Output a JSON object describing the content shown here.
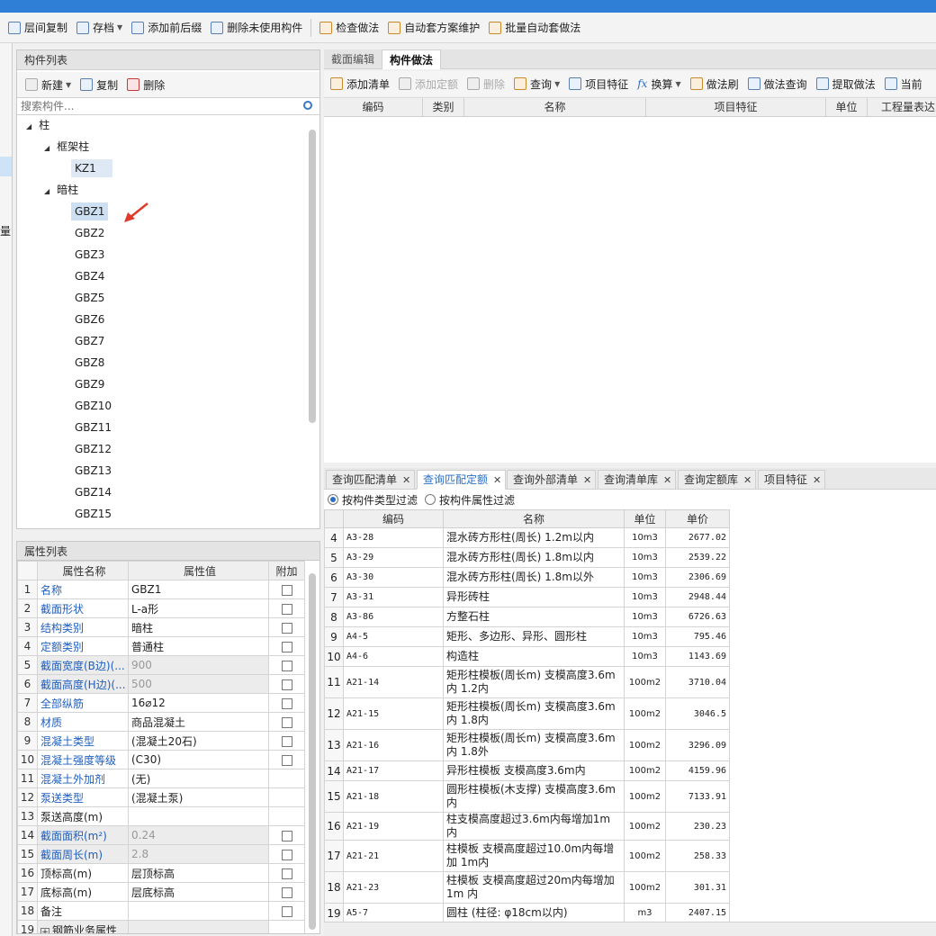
{
  "toolbar": {
    "items": [
      {
        "label": "层间复制",
        "icon": "copy-layers-icon"
      },
      {
        "label": "存档",
        "icon": "save-icon",
        "dropdown": true
      },
      {
        "label": "添加前后缀",
        "icon": "prefix-icon"
      },
      {
        "label": "删除未使用构件",
        "icon": "delete-unused-icon"
      },
      {
        "label": "检查做法",
        "icon": "check-method-icon"
      },
      {
        "label": "自动套方案维护",
        "icon": "auto-scheme-icon"
      },
      {
        "label": "批量自动套做法",
        "icon": "batch-auto-icon"
      }
    ]
  },
  "left_strip": {
    "partial_text": "用量"
  },
  "component_list": {
    "title": "构件列表",
    "new_label": "新建",
    "copy_label": "复制",
    "delete_label": "删除",
    "search_placeholder": "搜索构件...",
    "tree": {
      "root": "柱",
      "groups": [
        {
          "label": "框架柱",
          "items": [
            "KZ1"
          ]
        },
        {
          "label": "暗柱",
          "items": [
            "GBZ1",
            "GBZ2",
            "GBZ3",
            "GBZ4",
            "GBZ5",
            "GBZ6",
            "GBZ7",
            "GBZ8",
            "GBZ9",
            "GBZ10",
            "GBZ11",
            "GBZ12",
            "GBZ13",
            "GBZ14",
            "GBZ15"
          ]
        }
      ]
    }
  },
  "property_list": {
    "title": "属性列表",
    "headers": [
      "属性名称",
      "属性值",
      "附加"
    ],
    "rows": [
      {
        "n": "1",
        "name": "名称",
        "value": "GBZ1"
      },
      {
        "n": "2",
        "name": "截面形状",
        "value": "L-a形"
      },
      {
        "n": "3",
        "name": "结构类别",
        "value": "暗柱"
      },
      {
        "n": "4",
        "name": "定额类别",
        "value": "普通柱"
      },
      {
        "n": "5",
        "name": "截面宽度(B边)(...",
        "value": "900"
      },
      {
        "n": "6",
        "name": "截面高度(H边)(...",
        "value": "500"
      },
      {
        "n": "7",
        "name": "全部纵筋",
        "value": "16⌀12"
      },
      {
        "n": "8",
        "name": "材质",
        "value": "商品混凝土"
      },
      {
        "n": "9",
        "name": "混凝土类型",
        "value": "(混凝土20石)"
      },
      {
        "n": "10",
        "name": "混凝土强度等级",
        "value": "(C30)"
      },
      {
        "n": "11",
        "name": "混凝土外加剂",
        "value": "(无)"
      },
      {
        "n": "12",
        "name": "泵送类型",
        "value": "(混凝土泵)"
      },
      {
        "n": "13",
        "name": "泵送高度(m)",
        "value": ""
      },
      {
        "n": "14",
        "name": "截面面积(m²)",
        "value": "0.24"
      },
      {
        "n": "15",
        "name": "截面周长(m)",
        "value": "2.8"
      },
      {
        "n": "16",
        "name": "顶标高(m)",
        "value": "层顶标高"
      },
      {
        "n": "17",
        "name": "底标高(m)",
        "value": "层底标高"
      },
      {
        "n": "18",
        "name": "备注",
        "value": ""
      },
      {
        "n": "19",
        "name": "钢筋业务属性",
        "value": ""
      }
    ]
  },
  "right_tabs": {
    "section_edit": "截面编辑",
    "component_method": "构件做法"
  },
  "right_toolbar": {
    "add_list": "添加清单",
    "add_quota": "添加定额",
    "delete": "删除",
    "query": "查询",
    "item_feature": "项目特征",
    "convert": "换算",
    "method_brush": "做法刷",
    "method_query": "做法查询",
    "extract_method": "提取做法",
    "current": "当前"
  },
  "method_grid_headers": [
    "编码",
    "类别",
    "名称",
    "项目特征",
    "单位",
    "工程量表达"
  ],
  "bottom_tabs": [
    "查询匹配清单",
    "查询匹配定额",
    "查询外部清单",
    "查询清单库",
    "查询定额库",
    "项目特征"
  ],
  "filters": {
    "by_type": "按构件类型过滤",
    "by_attr": "按构件属性过滤"
  },
  "quota_table": {
    "headers": [
      "编码",
      "名称",
      "单位",
      "单价"
    ],
    "rows": [
      {
        "n": "4",
        "code": "A3-28",
        "name": "混水砖方形柱(周长) 1.2m以内",
        "unit": "10m3",
        "price": "2677.02"
      },
      {
        "n": "5",
        "code": "A3-29",
        "name": "混水砖方形柱(周长) 1.8m以内",
        "unit": "10m3",
        "price": "2539.22"
      },
      {
        "n": "6",
        "code": "A3-30",
        "name": "混水砖方形柱(周长) 1.8m以外",
        "unit": "10m3",
        "price": "2306.69"
      },
      {
        "n": "7",
        "code": "A3-31",
        "name": "异形砖柱",
        "unit": "10m3",
        "price": "2948.44"
      },
      {
        "n": "8",
        "code": "A3-86",
        "name": "方整石柱",
        "unit": "10m3",
        "price": "6726.63"
      },
      {
        "n": "9",
        "code": "A4-5",
        "name": "矩形、多边形、异形、圆形柱",
        "unit": "10m3",
        "price": "795.46"
      },
      {
        "n": "10",
        "code": "A4-6",
        "name": "构造柱",
        "unit": "10m3",
        "price": "1143.69"
      },
      {
        "n": "11",
        "code": "A21-14",
        "name": "矩形柱模板(周长m) 支模高度3.6m内 1.2内",
        "unit": "100m2",
        "price": "3710.04"
      },
      {
        "n": "12",
        "code": "A21-15",
        "name": "矩形柱模板(周长m) 支模高度3.6m内 1.8内",
        "unit": "100m2",
        "price": "3046.5"
      },
      {
        "n": "13",
        "code": "A21-16",
        "name": "矩形柱模板(周长m) 支模高度3.6m内 1.8外",
        "unit": "100m2",
        "price": "3296.09"
      },
      {
        "n": "14",
        "code": "A21-17",
        "name": "异形柱模板 支模高度3.6m内",
        "unit": "100m2",
        "price": "4159.96"
      },
      {
        "n": "15",
        "code": "A21-18",
        "name": "圆形柱模板(木支撑) 支模高度3.6m 内",
        "unit": "100m2",
        "price": "7133.91"
      },
      {
        "n": "16",
        "code": "A21-19",
        "name": "柱支模高度超过3.6m内每增加1m内",
        "unit": "100m2",
        "price": "230.23"
      },
      {
        "n": "17",
        "code": "A21-21",
        "name": "柱模板 支模高度超过10.0m内每增加 1m内",
        "unit": "100m2",
        "price": "258.33"
      },
      {
        "n": "18",
        "code": "A21-23",
        "name": "柱模板 支模高度超过20m内每增加1m 内",
        "unit": "100m2",
        "price": "301.31"
      },
      {
        "n": "19",
        "code": "A5-7",
        "name": "圆柱 (柱径: φ18cm以内)",
        "unit": "m3",
        "price": "2407.15"
      }
    ]
  },
  "colors": {
    "accent": "#2f7fd6",
    "link_blue": "#1f5fbf",
    "arrow_red": "#e03a2a"
  }
}
